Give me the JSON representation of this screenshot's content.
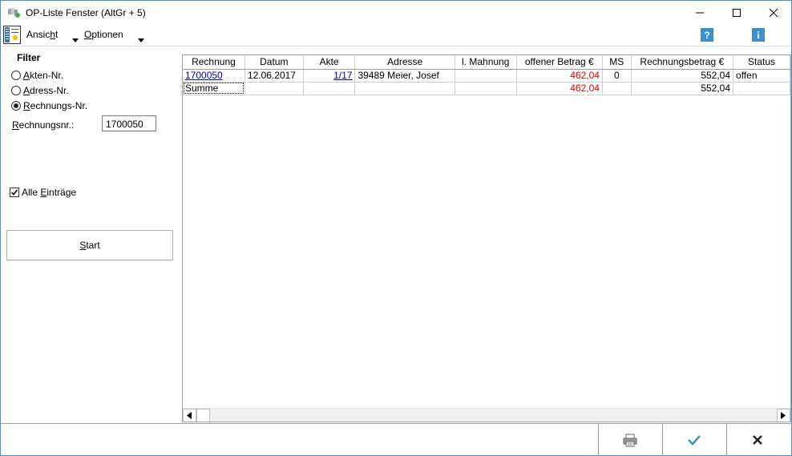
{
  "window": {
    "title": "OP-Liste Fenster (AltGr + 5)"
  },
  "menu": {
    "ansicht_pre": "Ansic",
    "ansicht_ul": "h",
    "ansicht_post": "t",
    "optionen_ul": "O",
    "optionen_post": "ptionen"
  },
  "filter": {
    "title": "Filter",
    "options": [
      {
        "ul": "A",
        "rest": "kten-Nr.",
        "checked": false
      },
      {
        "ul": "A",
        "rest": "dress-Nr.",
        "checked": false
      },
      {
        "ul": "R",
        "rest": "echnungs-Nr.",
        "checked": true
      }
    ],
    "rn_ul": "R",
    "rn_rest": "echnungsnr.:",
    "rn_value": "1700050",
    "alle_pre": "Alle ",
    "alle_ul": "E",
    "alle_post": "inträge",
    "alle_checked": true,
    "start_ul": "S",
    "start_rest": "tart"
  },
  "table": {
    "columns": [
      "Rechnung",
      "Datum",
      "Akte",
      "Adresse",
      "l. Mahnung",
      "offener Betrag €",
      "MS",
      "Rechnungsbetrag €",
      "Status"
    ],
    "rows": [
      {
        "rechnung": "1700050",
        "datum": "12.06.2017",
        "akte": "1/17",
        "adresse": "39489 Meier, Josef",
        "mahnung": "",
        "offen": "462,04",
        "ms": "0",
        "betrag": "552,04",
        "status": "offen"
      }
    ],
    "summe": {
      "label": "Summe",
      "offen": "462,04",
      "betrag": "552,04"
    }
  },
  "colors": {
    "accent_border": "#4a90c8",
    "red": "#e00000",
    "link": "#0000cc"
  },
  "icons": [
    "app-icon",
    "view-menu-icon",
    "help-icon",
    "info-icon",
    "print-icon",
    "checkmark-icon",
    "close-x-icon"
  ]
}
